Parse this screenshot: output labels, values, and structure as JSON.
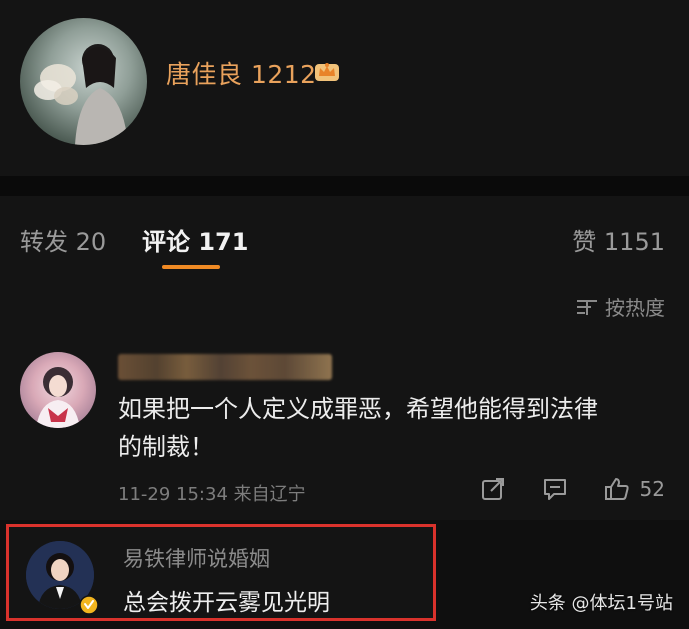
{
  "profile": {
    "username": "唐佳良 1212",
    "badge_icon": "crown-icon"
  },
  "tabs": [
    {
      "label": "转发 20",
      "active": false
    },
    {
      "label": "评论 171",
      "active": true
    },
    {
      "label": "赞 1151",
      "active": false
    }
  ],
  "sort": {
    "label": "按热度",
    "icon": "sort-icon"
  },
  "comment": {
    "text": "如果把一个人定义成罪恶，希望他能得到法律\n的制裁！",
    "meta": "11-29 15:34 来自辽宁",
    "likes": "52",
    "icons": [
      "share-icon",
      "reply-icon",
      "like-icon"
    ]
  },
  "reply": {
    "name": "易铁律师说婚姻",
    "text": "总会拨开云雾见光明",
    "badge_icon": "verified-icon"
  },
  "watermark": "头条 @体坛1号站",
  "colors": {
    "background": "#141414",
    "username": "#e9a25c",
    "tab_underline": "#f08a24",
    "highlight_border": "#d9322c"
  }
}
